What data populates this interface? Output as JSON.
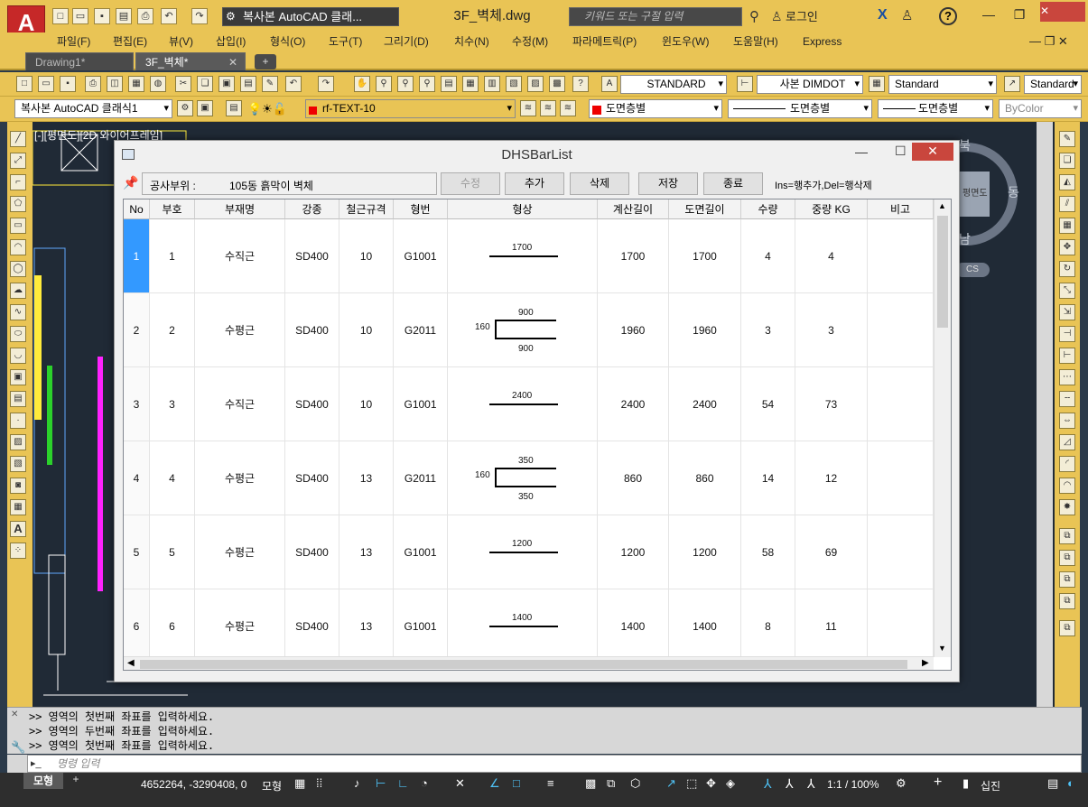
{
  "titlebar": {
    "app_letter": "A",
    "workspace": "복사본 AutoCAD 클래...",
    "document_title": "3F_벽체.dwg",
    "search_placeholder": "키워드 또는 구절 입력",
    "login": "로그인"
  },
  "menu": [
    "파일(F)",
    "편집(E)",
    "뷰(V)",
    "삽입(I)",
    "형식(O)",
    "도구(T)",
    "그리기(D)",
    "치수(N)",
    "수정(M)",
    "파라메트릭(P)",
    "윈도우(W)",
    "도움말(H)",
    "Express"
  ],
  "tabs": [
    "Drawing1*",
    "3F_벽체*"
  ],
  "toolbar": {
    "text_style": "STANDARD",
    "dim_style": "사본 DIMDOT",
    "table_style": "Standard",
    "mleader_style": "Standard",
    "workspace_combo": "복사본 AutoCAD 클래식1",
    "layer": "rf-TEXT-10",
    "color": "도면층별",
    "linetype": "도면층별",
    "lineweight": "도면층별",
    "plotstyle": "ByColor"
  },
  "viewport": {
    "label": "[-][평면도][2D 와이어프레임]",
    "compass": [
      "북",
      "동",
      "남"
    ],
    "viewcube_face": "평면도",
    "ucs": "CS"
  },
  "dialog": {
    "title": "DHSBarList",
    "site_label": "공사부위 :",
    "site_value": "105동 흙막이 벽체",
    "buttons": [
      "수정",
      "추가",
      "삭제",
      "저장",
      "종료"
    ],
    "hint": "Ins=행추가,Del=행삭제",
    "columns": [
      "No",
      "부호",
      "부재명",
      "강종",
      "철근규격",
      "형번",
      "형상",
      "계산길이",
      "도면길이",
      "수량",
      "중량 KG",
      "비고"
    ],
    "rows": [
      {
        "no": "1",
        "code": "1",
        "name": "수직근",
        "grade": "SD400",
        "size": "10",
        "shape_no": "G1001",
        "shape": {
          "type": "straight",
          "top": "1700"
        },
        "calc": "1700",
        "draw": "1700",
        "qty": "4",
        "weight": "4",
        "note": ""
      },
      {
        "no": "2",
        "code": "2",
        "name": "수평근",
        "grade": "SD400",
        "size": "10",
        "shape_no": "G2011",
        "shape": {
          "type": "bracket",
          "top": "900",
          "left": "160",
          "bottom": "900"
        },
        "calc": "1960",
        "draw": "1960",
        "qty": "3",
        "weight": "3",
        "note": ""
      },
      {
        "no": "3",
        "code": "3",
        "name": "수직근",
        "grade": "SD400",
        "size": "10",
        "shape_no": "G1001",
        "shape": {
          "type": "straight",
          "top": "2400"
        },
        "calc": "2400",
        "draw": "2400",
        "qty": "54",
        "weight": "73",
        "note": ""
      },
      {
        "no": "4",
        "code": "4",
        "name": "수평근",
        "grade": "SD400",
        "size": "13",
        "shape_no": "G2011",
        "shape": {
          "type": "bracket",
          "top": "350",
          "left": "160",
          "bottom": "350"
        },
        "calc": "860",
        "draw": "860",
        "qty": "14",
        "weight": "12",
        "note": ""
      },
      {
        "no": "5",
        "code": "5",
        "name": "수평근",
        "grade": "SD400",
        "size": "13",
        "shape_no": "G1001",
        "shape": {
          "type": "straight",
          "top": "1200"
        },
        "calc": "1200",
        "draw": "1200",
        "qty": "58",
        "weight": "69",
        "note": ""
      },
      {
        "no": "6",
        "code": "6",
        "name": "수평근",
        "grade": "SD400",
        "size": "13",
        "shape_no": "G1001",
        "shape": {
          "type": "straight",
          "top": "1400"
        },
        "calc": "1400",
        "draw": "1400",
        "qty": "8",
        "weight": "11",
        "note": ""
      }
    ]
  },
  "command": {
    "history": [
      ">> 영역의 첫번째 좌표를 입력하세요.",
      ">> 영역의 두번째 좌표를 입력하세요.",
      ">> 영역의 첫번째 좌표를 입력하세요."
    ],
    "placeholder": "명령 입력"
  },
  "status": {
    "layout_tab": "모형",
    "coords": "4652264, -3290408, 0",
    "model_label": "모형",
    "scale": "1:1 / 100%",
    "units": "십진"
  }
}
